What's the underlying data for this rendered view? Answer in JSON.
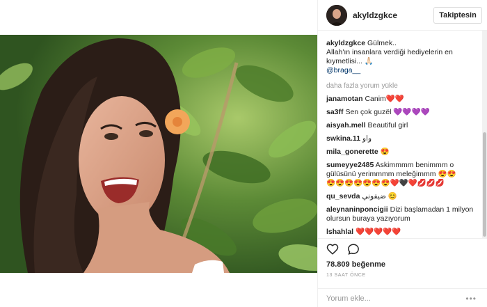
{
  "post": {
    "username": "akyldzgkce",
    "follow_label": "Takiptesin",
    "caption": {
      "username": "akyldzgkce",
      "line1": "Gülmek..",
      "line2": "Allah'ın insanlara verdiği hediyelerin en",
      "line3": "kıymetlisi... 🙏🏻",
      "mention": "@braga__"
    },
    "load_more": "daha fazla yorum yükle",
    "comments": [
      {
        "user": "janamotan",
        "text": "Canim❤️❤️"
      },
      {
        "user": "sa3ff",
        "text": "Sen çok guzël",
        "emoji": "💜💜💜💜"
      },
      {
        "user": "aisyah.mell",
        "text": "Beautiful girl"
      },
      {
        "user": "swkina.11",
        "text": "واو"
      },
      {
        "user": "mila_gonerette",
        "text": "😍"
      },
      {
        "user": "sumeyye2485",
        "text": "Askimmmm benimmm o gülüsünü yerimmmm meleğimmm 😍😍",
        "emoji": "😍😍😍😍😍😍😍❤️🖤❤️💋💋💋"
      },
      {
        "user": "qu_sevda",
        "text": "ضيفوني 😊"
      },
      {
        "user": "aleynaninponcigii",
        "text": "Dizi başlamadan 1 milyon olursun buraya yazıyorum"
      },
      {
        "user": "lshahlal",
        "text": "",
        "emoji": "❤️❤️❤️❤️❤️"
      }
    ],
    "likes": "78.809 beğenme",
    "timestamp": "13 SAAT ÖNCE",
    "comment_placeholder": "Yorum ekle...",
    "more_options": "•••",
    "icons": {
      "like": "heart-icon",
      "comment": "comment-bubble-icon",
      "more": "more-options-icon"
    },
    "colors": {
      "accent": "#003569",
      "muted": "#999999",
      "text": "#262626",
      "border": "#dbdbdb"
    }
  }
}
